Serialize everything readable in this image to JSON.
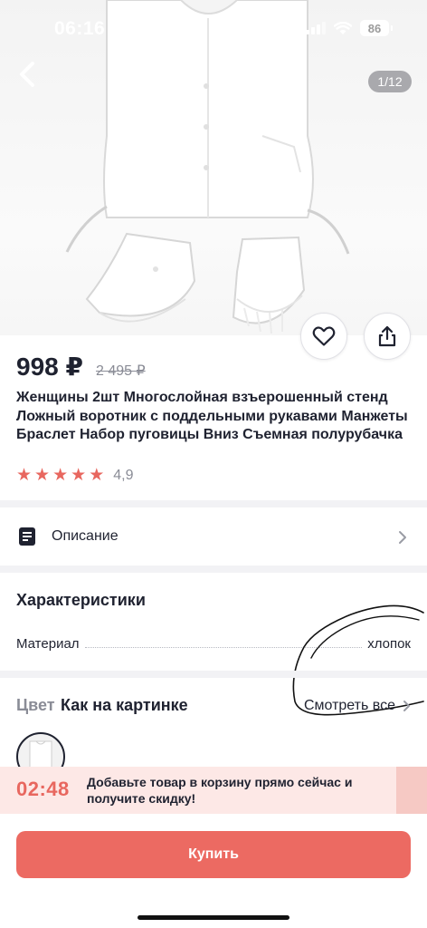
{
  "status_bar": {
    "time": "06:16",
    "battery": "86"
  },
  "gallery": {
    "counter": "1/12"
  },
  "product": {
    "price": "998 ₽",
    "old_price": "2 495 ₽",
    "title": "Женщины 2шт Многослойная взъерошенный стенд Ложный воротник с поддельными рукавами Манжеты Браслет Набор пуговицы Вниз Съемная полурубачка",
    "rating": "4,9",
    "stars": 5
  },
  "description": {
    "label": "Описание"
  },
  "characteristics": {
    "title": "Характеристики",
    "rows": [
      {
        "key": "Материал",
        "value": "хлопок"
      }
    ]
  },
  "color": {
    "label": "Цвет",
    "value": "Как на картинке",
    "see_all": "Смотреть все"
  },
  "promo": {
    "timer": "02:48",
    "text": "Добавьте товар в корзину прямо сейчас и получите скидку!"
  },
  "buy": {
    "label": "Купить"
  },
  "colors": {
    "accent": "#ec6a62",
    "star": "#e8675f",
    "promo_bg": "#fde8e6",
    "text": "#1f2230",
    "muted": "#8a8c96"
  }
}
